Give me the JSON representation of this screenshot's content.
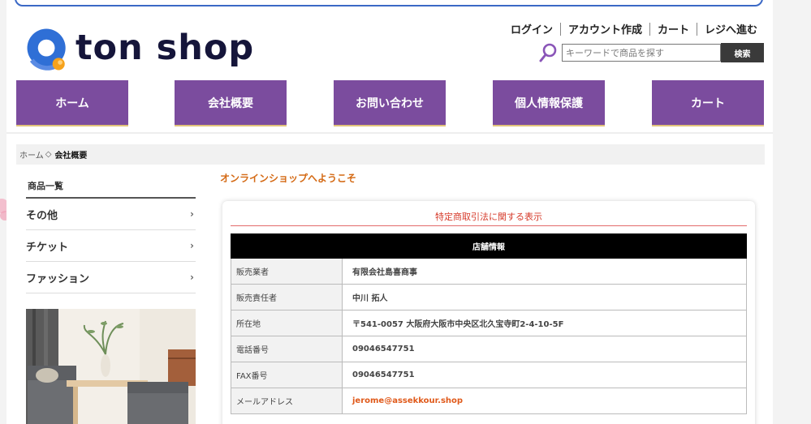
{
  "brand": {
    "name": "ton shop"
  },
  "header": {
    "top_links": [
      "ログイン",
      "アカウント作成",
      "カート",
      "レジへ進む"
    ],
    "search": {
      "placeholder": "キーワードで商品を探す",
      "button": "検索"
    }
  },
  "nav": {
    "items": [
      "ホーム",
      "会社概要",
      "お問い合わせ",
      "個人情報保護",
      "カート"
    ]
  },
  "breadcrumb": {
    "home": "ホーム",
    "separator": "◇",
    "current": "会社概要"
  },
  "sidebar": {
    "heading": "商品一覧",
    "items": [
      "その他",
      "チケット",
      "ファッション"
    ]
  },
  "main": {
    "welcome": "オンラインショップへようこそ",
    "law_title": "特定商取引法に関する表示",
    "table_header": "店舗情報",
    "rows": [
      {
        "key": "販売業者",
        "value": "有限会社島喜商事"
      },
      {
        "key": "販売責任者",
        "value": "中川 拓人"
      },
      {
        "key": "所在地",
        "value": "〒541-0057 大阪府大阪市中央区北久宝寺町2-4-10-5F"
      },
      {
        "key": "電話番号",
        "value": "09046547751"
      },
      {
        "key": "FAX番号",
        "value": "09046547751"
      },
      {
        "key": "メールアドレス",
        "value": "jerome@assekkour.shop"
      }
    ]
  },
  "colors": {
    "nav_purple": "#7b4c9e",
    "nav_underline": "#e1c27a",
    "accent_orange": "#d46a15",
    "law_red": "#d63b2b",
    "link_orange": "#e05a1b",
    "logo_blue": "#2f6fd6",
    "logo_orange": "#f6a21c"
  },
  "icons": {
    "logo": "brand-logo-icon",
    "search": "search-icon",
    "chevron": "chevron-right-icon"
  }
}
